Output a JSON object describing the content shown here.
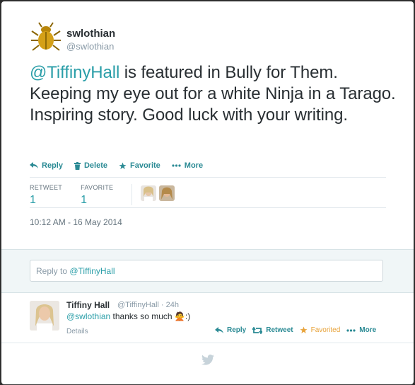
{
  "tweet": {
    "username": "swlothian",
    "handle": "@swlothian",
    "mention": "@TiffinyHall",
    "text_after_mention": " is featured in Bully for Them. Keeping my eye out for a white Ninja in a Tarago. Inspiring story. Good luck with your writing.",
    "timestamp": "10:12 AM - 16 May 2014"
  },
  "actions": {
    "reply": "Reply",
    "delete": "Delete",
    "favorite": "Favorite",
    "more": "More"
  },
  "stats": {
    "retweet_label": "RETWEET",
    "retweet_count": "1",
    "favorite_label": "FAVORITE",
    "favorite_count": "1"
  },
  "reply_box": {
    "prefix": "Reply to ",
    "mention": "@TiffinyHall"
  },
  "reply_tweet": {
    "name": "Tiffiny Hall",
    "handle": "@TiffinyHall",
    "time": " · 24h",
    "mention": "@swlothian",
    "text": " thanks so much 🙅:)",
    "details": "Details",
    "reply": "Reply",
    "retweet": "Retweet",
    "favorited": "Favorited",
    "more": "More"
  },
  "colors": {
    "accent": "#2a9ea8",
    "favorited": "#e8a33a",
    "reply_area_bg": "#f0f6f7"
  },
  "icons": [
    "scarab-beetle-avatar",
    "reply-icon",
    "trash-icon",
    "star-icon",
    "more-dots-icon",
    "retweet-icon",
    "twitter-bird-icon"
  ]
}
